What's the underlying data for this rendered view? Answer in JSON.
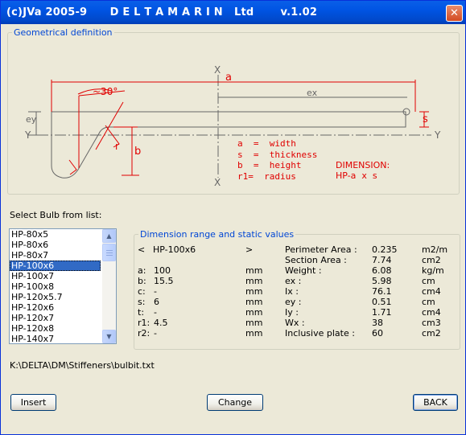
{
  "window": {
    "title": "(c)JVa 2005-9      D E L T A M A R I N   Ltd       v.1.02",
    "close_glyph": "✕"
  },
  "geometry": {
    "legend": "Geometrical definition",
    "labels": {
      "a": "a",
      "ex": "ex",
      "ey": "ey",
      "s": "s",
      "b": "b",
      "r": "r",
      "angle": "~30°",
      "x_top": "X",
      "x_bottom": "X",
      "y_left": "Y",
      "y_right": "Y"
    },
    "legend_lines": [
      "a  =  width",
      "s  =  thickness",
      "b  =  height",
      "r1=  radius"
    ],
    "dimension_caption": "DIMENSION:",
    "dimension_format": "HP-a  x  s"
  },
  "select_label": "Select Bulb from list:",
  "bulbs": [
    "HP-80x5",
    "HP-80x6",
    "HP-80x7",
    "HP-100x6",
    "HP-100x7",
    "HP-100x8",
    "HP-120x5.7",
    "HP-120x6",
    "HP-120x7",
    "HP-120x8",
    "HP-140x7"
  ],
  "selected_bulb": "HP-100x6",
  "dimension_panel": {
    "legend": "Dimension range and static values",
    "prev": "<",
    "next": ">",
    "current": "HP-100x6",
    "params": [
      {
        "name": "a:",
        "value": "100",
        "unit": "mm"
      },
      {
        "name": "b:",
        "value": "15.5",
        "unit": "mm"
      },
      {
        "name": "c:",
        "value": "-",
        "unit": "mm"
      },
      {
        "name": "s:",
        "value": "6",
        "unit": "mm"
      },
      {
        "name": "t:",
        "value": "-",
        "unit": "mm"
      },
      {
        "name": "r1:",
        "value": "4.5",
        "unit": "mm"
      },
      {
        "name": "r2:",
        "value": "-",
        "unit": "mm"
      }
    ],
    "statics": [
      {
        "name": "Perimeter Area :",
        "value": "0.235",
        "unit": "m2/m"
      },
      {
        "name": "Section Area :",
        "value": "7.74",
        "unit": "cm2"
      },
      {
        "name": "Weight :",
        "value": "6.08",
        "unit": "kg/m"
      },
      {
        "name": "ex :",
        "value": "5.98",
        "unit": "cm"
      },
      {
        "name": "Ix :",
        "value": "76.1",
        "unit": "cm4"
      },
      {
        "name": "ey :",
        "value": "0.51",
        "unit": "cm"
      },
      {
        "name": "Iy :",
        "value": "1.71",
        "unit": "cm4"
      },
      {
        "name": "Wx :",
        "value": "38",
        "unit": "cm3"
      },
      {
        "name": "Inclusive plate :",
        "value": "60",
        "unit": "cm2"
      }
    ]
  },
  "file_path": "K:\\DELTA\\DM\\Stiffeners\\bulbit.txt",
  "buttons": {
    "insert": "Insert",
    "change": "Change",
    "back": "BACK"
  },
  "colors": {
    "accent": "#0046d5",
    "drawing_red": "#e00000",
    "selection": "#316ac5"
  }
}
